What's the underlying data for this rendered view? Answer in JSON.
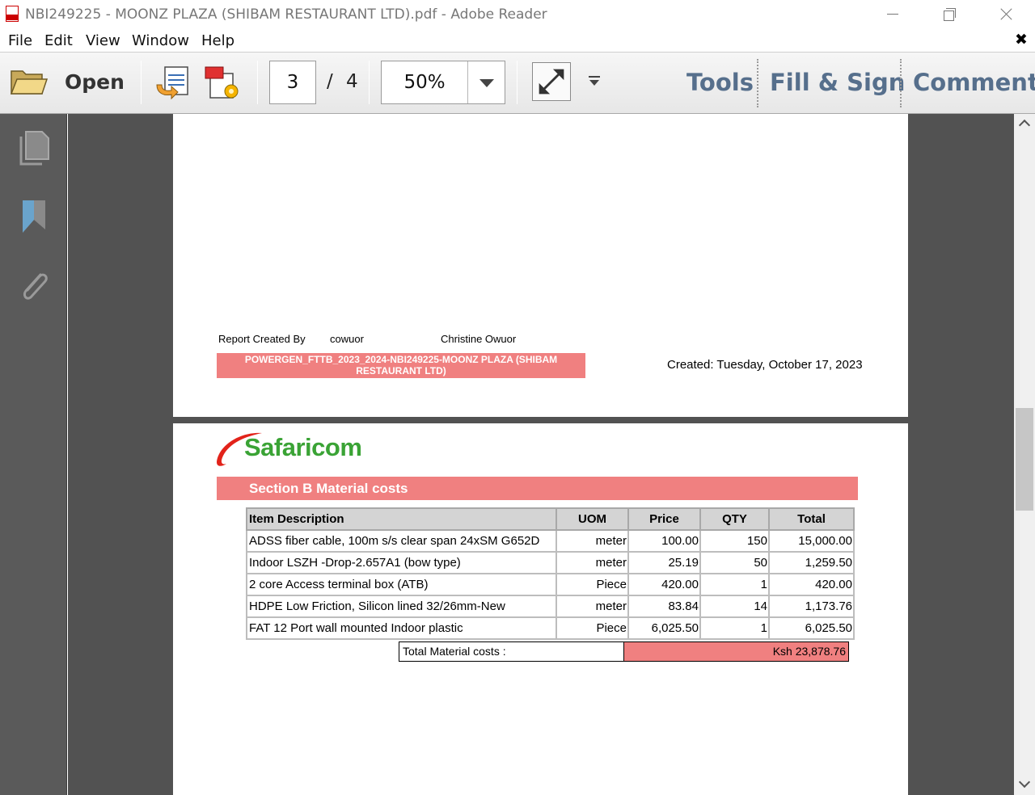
{
  "window": {
    "title": "NBI249225 - MOONZ PLAZA (SHIBAM RESTAURANT LTD).pdf - Adobe Reader"
  },
  "menu": {
    "items": [
      "File",
      "Edit",
      "View",
      "Window",
      "Help"
    ],
    "close_glyph": "✖"
  },
  "toolbar": {
    "open_label": "Open",
    "current_page": "3",
    "page_separator": "/",
    "total_pages": "4",
    "zoom": "50%",
    "tools_label": "Tools",
    "fill_sign_label": "Fill & Sign",
    "comment_label": "Comment"
  },
  "report": {
    "created_by_label": "Report Created By",
    "user_id": "cowuor",
    "user_name": "Christine Owuor",
    "banner": "POWERGEN_FTTB_2023_2024-NBI249225-MOONZ PLAZA (SHIBAM RESTAURANT LTD)",
    "created": "Created: Tuesday, October 17, 2023"
  },
  "logo_text": "Safaricom",
  "section": {
    "title": "Section B Material costs"
  },
  "material_table": {
    "headers": [
      "Item Description",
      "UOM",
      "Price",
      "QTY",
      "Total"
    ],
    "rows": [
      [
        "ADSS fiber cable, 100m s/s clear span 24xSM G652D",
        "meter",
        "100.00",
        "150",
        "15,000.00"
      ],
      [
        "Indoor LSZH -Drop-2.657A1 (bow type)",
        "meter",
        "25.19",
        "50",
        "1,259.50"
      ],
      [
        "2 core Access terminal box (ATB)",
        "Piece",
        "420.00",
        "1",
        "420.00"
      ],
      [
        "HDPE Low Friction, Silicon lined 32/26mm-New",
        "meter",
        "83.84",
        "14",
        "1,173.76"
      ],
      [
        "FAT 12 Port wall mounted Indoor plastic",
        "Piece",
        "6,025.50",
        "1",
        "6,025.50"
      ]
    ],
    "total_label": "Total Material costs :",
    "total_value": "Ksh 23,878.76"
  },
  "colors": {
    "accent_salmon": "#f08080",
    "toolbar_text": "#566f8c",
    "safaricom_green": "#3aa335",
    "safaricom_red": "#e2231a",
    "nav_panel": "#5a5a5a",
    "doc_background": "#525252"
  },
  "icons": {
    "open": "folder-icon",
    "export": "export-pdf-icon",
    "create": "create-pdf-icon",
    "expand": "expand-arrows-icon",
    "more": "more-tools-icon",
    "nav_pages": "pages-icon",
    "nav_bookmarks": "bookmark-icon",
    "nav_attachments": "paperclip-icon"
  }
}
